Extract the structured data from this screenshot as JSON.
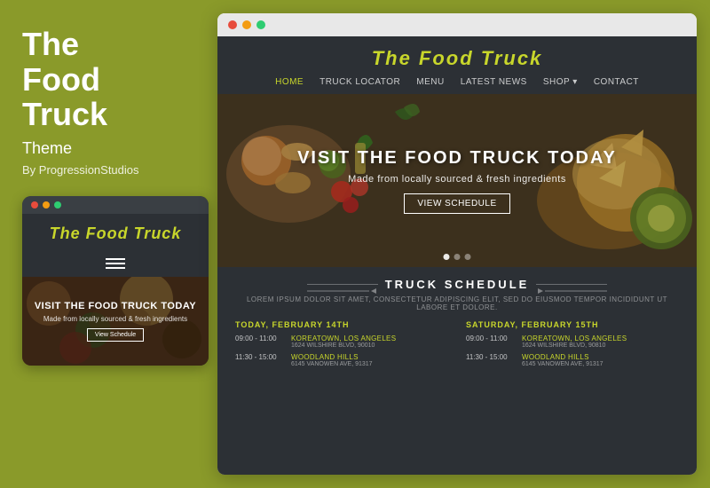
{
  "left": {
    "title_line1": "The",
    "title_line2": "Food",
    "title_line3": "Truck",
    "subtitle": "Theme",
    "by": "By ProgressionStudios"
  },
  "mobile": {
    "logo": "The Food Truck",
    "hero_title": "VISIT THE FOOD TRUCK TODAY",
    "hero_sub": "Made from locally sourced & fresh ingredients",
    "btn": "View Schedule"
  },
  "browser": {
    "topbar_dots": [
      "red",
      "yellow",
      "green"
    ],
    "site": {
      "logo": "The Food Truck",
      "nav": [
        {
          "label": "Home",
          "active": true
        },
        {
          "label": "Truck Locator",
          "active": false
        },
        {
          "label": "Menu",
          "active": false
        },
        {
          "label": "Latest News",
          "active": false
        },
        {
          "label": "Shop",
          "active": false,
          "has_arrow": true
        },
        {
          "label": "Contact",
          "active": false
        }
      ],
      "hero": {
        "title": "VISIT THE FOOD TRUCK TODAY",
        "subtitle": "Made from locally sourced & fresh ingredients",
        "cta": "View Schedule"
      },
      "schedule": {
        "heading": "TRUCK SCHEDULE",
        "subtitle": "LOREM IPSUM DOLOR SIT AMET, CONSECTETUR ADIPISCING ELIT, SED DO EIUSMOD TEMPOR INCIDIDUNT UT LABORE ET DOLORE.",
        "columns": [
          {
            "day": "TODAY, FEBRUARY 14TH",
            "rows": [
              {
                "time": "09:00 - 11:00",
                "location": "KOREATOWN, LOS ANGELES",
                "address": "1624 WILSHIRE BLVD, 90010"
              },
              {
                "time": "11:30 - 15:00",
                "location": "WOODLAND HILLS",
                "address": "6145 VANOWEN AVE, 91317"
              }
            ]
          },
          {
            "day": "SATURDAY, FEBRUARY 15TH",
            "rows": [
              {
                "time": "09:00 - 11:00",
                "location": "KOREATOWN, LOS ANGELES",
                "address": "1624 WILSHIRE BLVD, 90810"
              },
              {
                "time": "11:30 - 15:00",
                "location": "WOODLAND HILLS",
                "address": "6145 VANOWEN AVE, 91317"
              }
            ]
          }
        ]
      }
    }
  }
}
